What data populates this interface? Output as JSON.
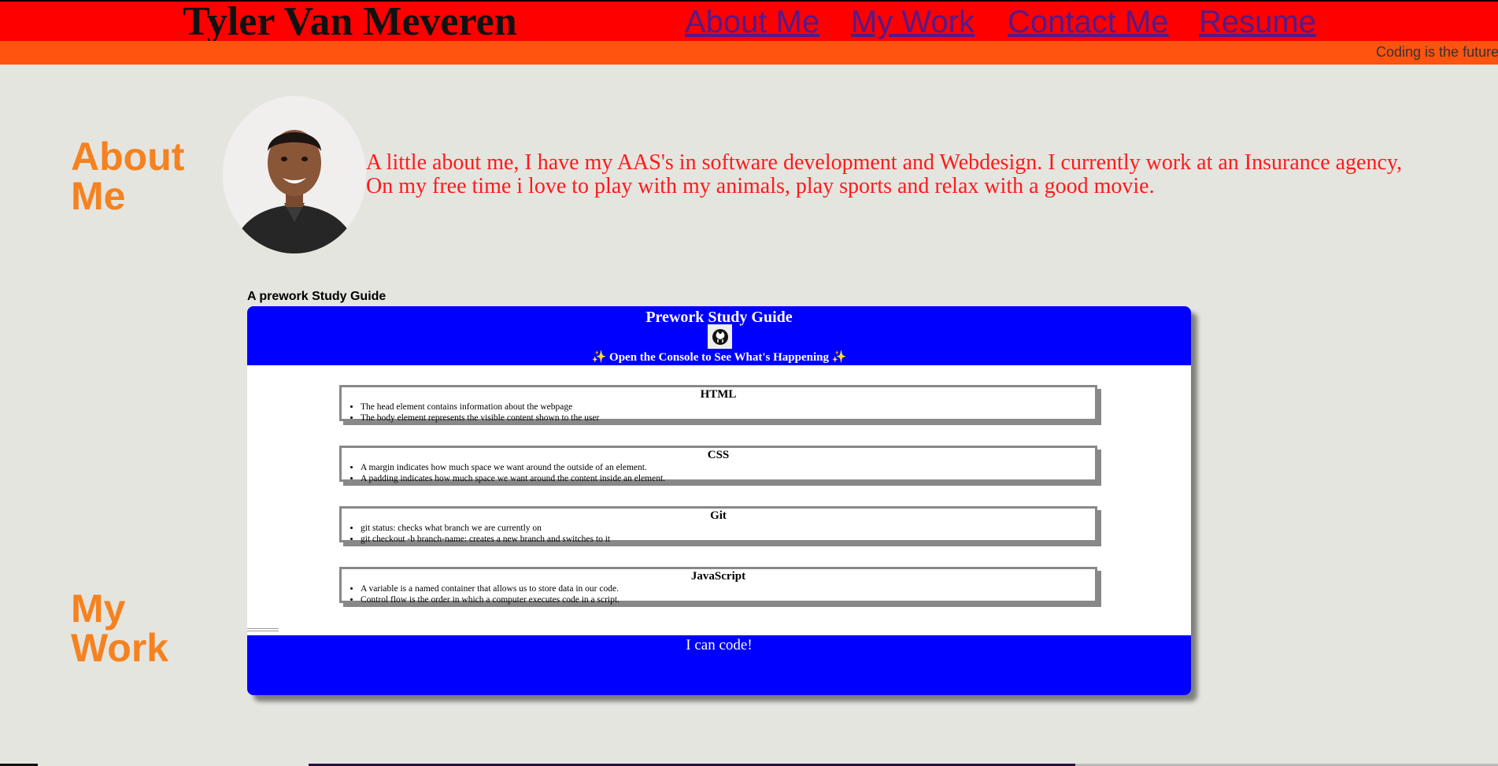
{
  "header": {
    "site_title": "Tyler Van Meveren",
    "nav": [
      "About Me",
      "My Work",
      "Contact Me",
      "Resume"
    ],
    "marquee_text": "Coding is the future"
  },
  "about": {
    "heading": "About Me",
    "text": "A little about me, I have my AAS's in software development and Webdesign. I currently work at an Insurance agency, On my free time i love to play with my animals, play sports and relax with a good movie."
  },
  "work": {
    "heading": "My Work",
    "caption": "A prework Study Guide"
  },
  "guide": {
    "title": "Prework Study Guide",
    "console_note": "✨ Open the Console to See What's Happening ✨",
    "footer": "I can code!",
    "cards": [
      {
        "title": "HTML",
        "items": [
          "The head element contains information about the webpage",
          "The body element represents the visible content shown to the user"
        ]
      },
      {
        "title": "CSS",
        "items": [
          "A margin indicates how much space we want around the outside of an element.",
          "A padding indicates how much space we want around the content inside an element."
        ]
      },
      {
        "title": "Git",
        "items": [
          "git status: checks what branch we are currently on",
          "git checkout -b branch-name: creates a new branch and switches to it"
        ]
      },
      {
        "title": "JavaScript",
        "items": [
          "A variable is a named container that allows us to store data in our code.",
          "Control flow is the order in which a computer executes code in a script."
        ]
      }
    ]
  },
  "colors": {
    "header_bg": "#ff0000",
    "marquee_bg": "#ff5310",
    "heading_orange": "#f58220",
    "about_text_red": "#ff1a1a",
    "guide_blue": "#0000ff",
    "page_bg": "#e5e5e0"
  },
  "icons": {
    "guide_logo": "github-octocat-icon",
    "profile_photo": "avatar"
  }
}
